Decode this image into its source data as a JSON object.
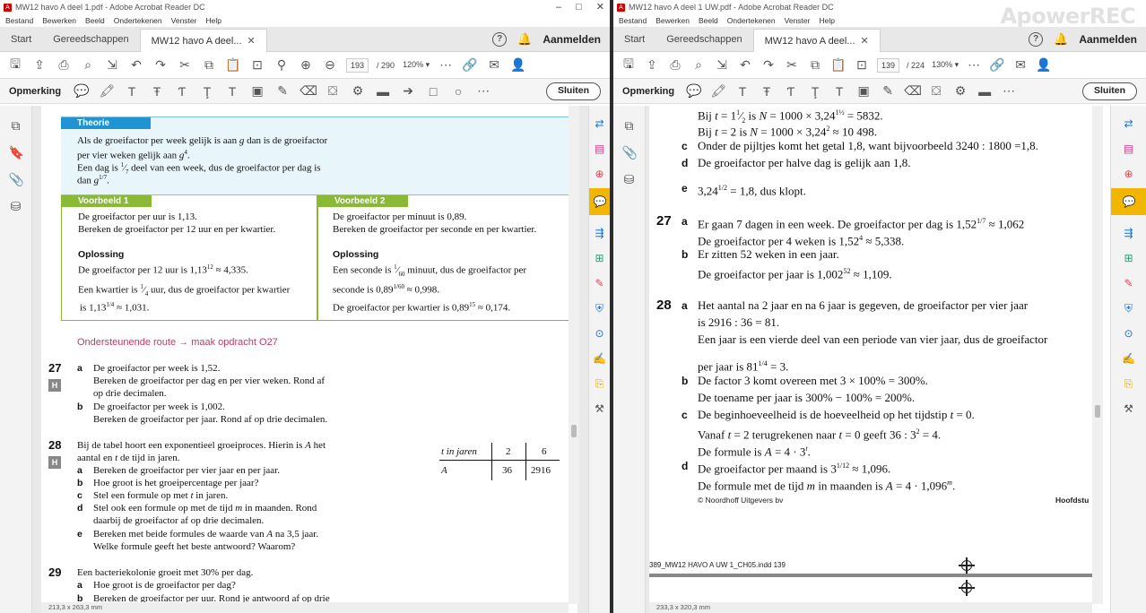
{
  "left": {
    "title": "MW12 havo A deel 1.pdf - Adobe Acrobat Reader DC",
    "menu": [
      "Bestand",
      "Bewerken",
      "Beeld",
      "Ondertekenen",
      "Venster",
      "Help"
    ],
    "tabs": {
      "start": "Start",
      "tools": "Gereedschappen",
      "doc": "MW12 havo A deel..."
    },
    "signin": "Aanmelden",
    "page_current": "193",
    "page_total": "/ 290",
    "zoom": "120%",
    "comment_label": "Opmerking",
    "close_label": "Sluiten",
    "status": "213,3 x 263,3 mm",
    "theory": {
      "header": "Theorie",
      "lines": [
        "Als de groeifactor per week gelijk is aan g dan is de groeifactor",
        "per vier weken gelijk aan g⁴.",
        "Een dag is ⅐ deel van een week, dus de groeifactor per dag is",
        "dan g^(1/7)."
      ]
    },
    "ex1": {
      "header": "Voorbeeld 1",
      "l1": "De groeifactor per uur is 1,13.",
      "l2": "Bereken de groeifactor per 12 uur en per kwartier.",
      "sol": "Oplossing",
      "l3": "De groeifactor per 12 uur is 1,13¹² ≈ 4,335.",
      "l4": "Een kwartier is ¼ uur, dus de groeifactor per kwartier",
      "l5": "is 1,13^(1/4) ≈ 1,031."
    },
    "ex2": {
      "header": "Voorbeeld 2",
      "l1": "De groeifactor per minuut is 0,89.",
      "l2": "Bereken de groeifactor per seconde en per kwartier.",
      "sol": "Oplossing",
      "l3": "Een seconde is 1/60 minuut, dus de groeifactor per",
      "l4": "seconde is 0,89^(1/60) ≈ 0,998.",
      "l5": "De groeifactor per kwartier is 0,89¹⁵ ≈ 0,174."
    },
    "route": "Ondersteunende route → maak opdracht O27",
    "q27": {
      "num": "27",
      "h": "H",
      "a": "a",
      "a1": "De groeifactor per week is 1,52.",
      "a2": "Bereken de groeifactor per dag en per vier weken. Rond af",
      "a3": "op drie decimalen.",
      "b": "b",
      "b1": "De groeifactor per week is 1,002.",
      "b2": "Bereken de groeifactor per jaar. Rond af op drie decimalen."
    },
    "q28": {
      "num": "28",
      "h": "H",
      "intro1": "Bij de tabel hoort een exponentieel groeiproces. Hierin is A het",
      "intro2": "aantal en t de tijd in jaren.",
      "a": "a",
      "at": "Bereken de groeifactor per vier jaar en per jaar.",
      "b": "b",
      "bt": "Hoe groot is het groeipercentage per jaar?",
      "c": "c",
      "ct": "Stel een formule op met t in jaren.",
      "d": "d",
      "dt1": "Stel ook een formule op met de tijd m in maanden. Rond",
      "dt2": "daarbij de groeifactor af op drie decimalen.",
      "e": "e",
      "et1": "Bereken met beide formules de waarde van A na 3,5 jaar.",
      "et2": "Welke formule geeft het beste antwoord? Waarom?",
      "table": {
        "h0": "t in jaren",
        "h1": "2",
        "h2": "6",
        "r0": "A",
        "r1": "36",
        "r2": "2916"
      }
    },
    "q29": {
      "num": "29",
      "intro": "Een bacteriekolonie groeit met 30% per dag.",
      "a": "a",
      "at": "Hoe groot is de groeifactor per dag?",
      "b": "b",
      "bt": "Bereken de groeifactor per uur. Rond je antwoord af op drie"
    }
  },
  "right": {
    "title": "MW12 havo A deel 1 UW.pdf - Adobe Acrobat Reader DC",
    "watermark": "ApowerREC",
    "menu": [
      "Bestand",
      "Bewerken",
      "Beeld",
      "Ondertekenen",
      "Venster",
      "Help"
    ],
    "tabs": {
      "start": "Start",
      "tools": "Gereedschappen",
      "doc": "MW12 havo A deel..."
    },
    "signin": "Aanmelden",
    "page_current": "139",
    "page_total": "/ 224",
    "zoom": "130%",
    "comment_label": "Opmerking",
    "close_label": "Sluiten",
    "status": "233,3 x 320,3 mm",
    "top1": "Bij t = 1½ is N = 1000 × 3,24^(1½) = 5832.",
    "top2": "Bij t = 2 is N = 1000 × 3,24² ≈ 10 498.",
    "c": "c",
    "ct": "Onder de pijltjes komt het getal 1,8, want bijvoorbeeld 3240 : 1800 =1,8.",
    "d": "d",
    "dt": "De groeifactor per halve dag is gelijk aan 1,8.",
    "e": "e",
    "et": "3,24^(1/2) = 1,8, dus klopt.",
    "q27": {
      "num": "27",
      "a": "a",
      "a1": "Er gaan 7 dagen in een week. De groeifactor per dag is 1,52^(1/7) ≈ 1,062",
      "a2": "De groeifactor per 4 weken is 1,52⁴ ≈ 5,338.",
      "b": "b",
      "b1": "Er zitten 52 weken in een jaar.",
      "b2": "De groeifactor per jaar is 1,002⁵² ≈ 1,109."
    },
    "q28": {
      "num": "28",
      "a": "a",
      "a1": "Het aantal na 2 jaar en na 6 jaar is gegeven, de groeifactor per vier jaar",
      "a2": "is 2916 : 36 = 81.",
      "a3": "Een jaar is een vierde deel van een periode van vier jaar, dus de groeifactor",
      "a4": "per jaar is 81^(1/4) = 3.",
      "b": "b",
      "b1": "De factor 3 komt overeen met 3 × 100% = 300%.",
      "b2": "De toename per jaar is 300% − 100% = 200%.",
      "c": "c",
      "c1": "De beginhoeveelheid is de hoeveelheid op het tijdstip t = 0.",
      "c2": "Vanaf t = 2 terugrekenen naar t = 0 geeft 36 : 3² = 4.",
      "c3": "De formule is A = 4 · 3ᵗ.",
      "d": "d",
      "d1": "De groeifactor per maand is 3^(1/12) ≈ 1,096.",
      "d2": "De formule met de tijd m in maanden is A = 4 · 1,096ᵐ."
    },
    "copyright": "© Noordhoff Uitgevers bv",
    "chapter": "Hoofdstu",
    "indd": "389_MW12 HAVO A UW 1_CH05.indd   139"
  }
}
